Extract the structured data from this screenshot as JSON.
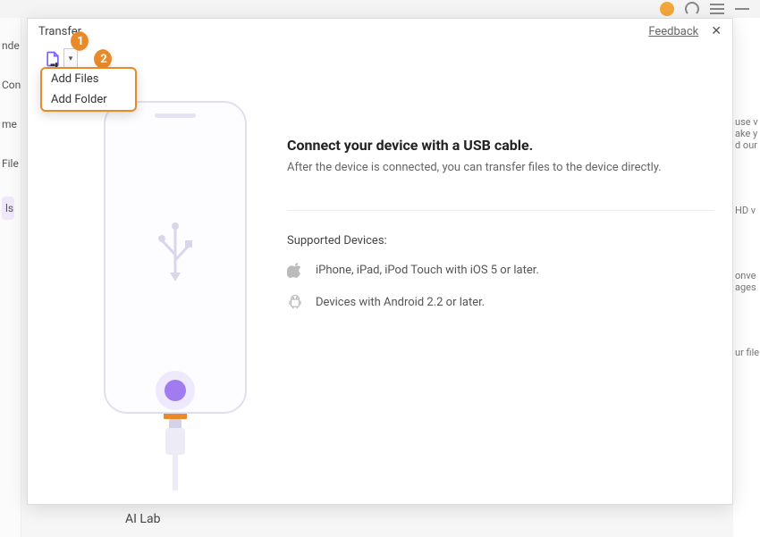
{
  "titlebar": {
    "minimize": "—"
  },
  "modal": {
    "title": "Transfer",
    "feedback": "Feedback",
    "toolbar": {
      "badge1": "1",
      "badge2": "2",
      "menu": {
        "add_files": "Add Files",
        "add_folder": "Add Folder"
      }
    },
    "content": {
      "heading": "Connect your device with a USB cable.",
      "subtitle": "After the device is connected, you can transfer files to the device directly.",
      "supported_label": "Supported Devices:",
      "device_apple": "iPhone, iPad, iPod Touch with iOS 5 or later.",
      "device_android": "Devices with Android 2.2 or later."
    }
  },
  "bg": {
    "sidebar": {
      "a": "nde",
      "b": "Con",
      "c": "me",
      "d": "File",
      "e": "ls"
    },
    "right": {
      "a": "use v\nake y\nd our",
      "b": "HD v",
      "c": "onve\nages",
      "d": "ur file"
    }
  },
  "footer": "AI Lab"
}
